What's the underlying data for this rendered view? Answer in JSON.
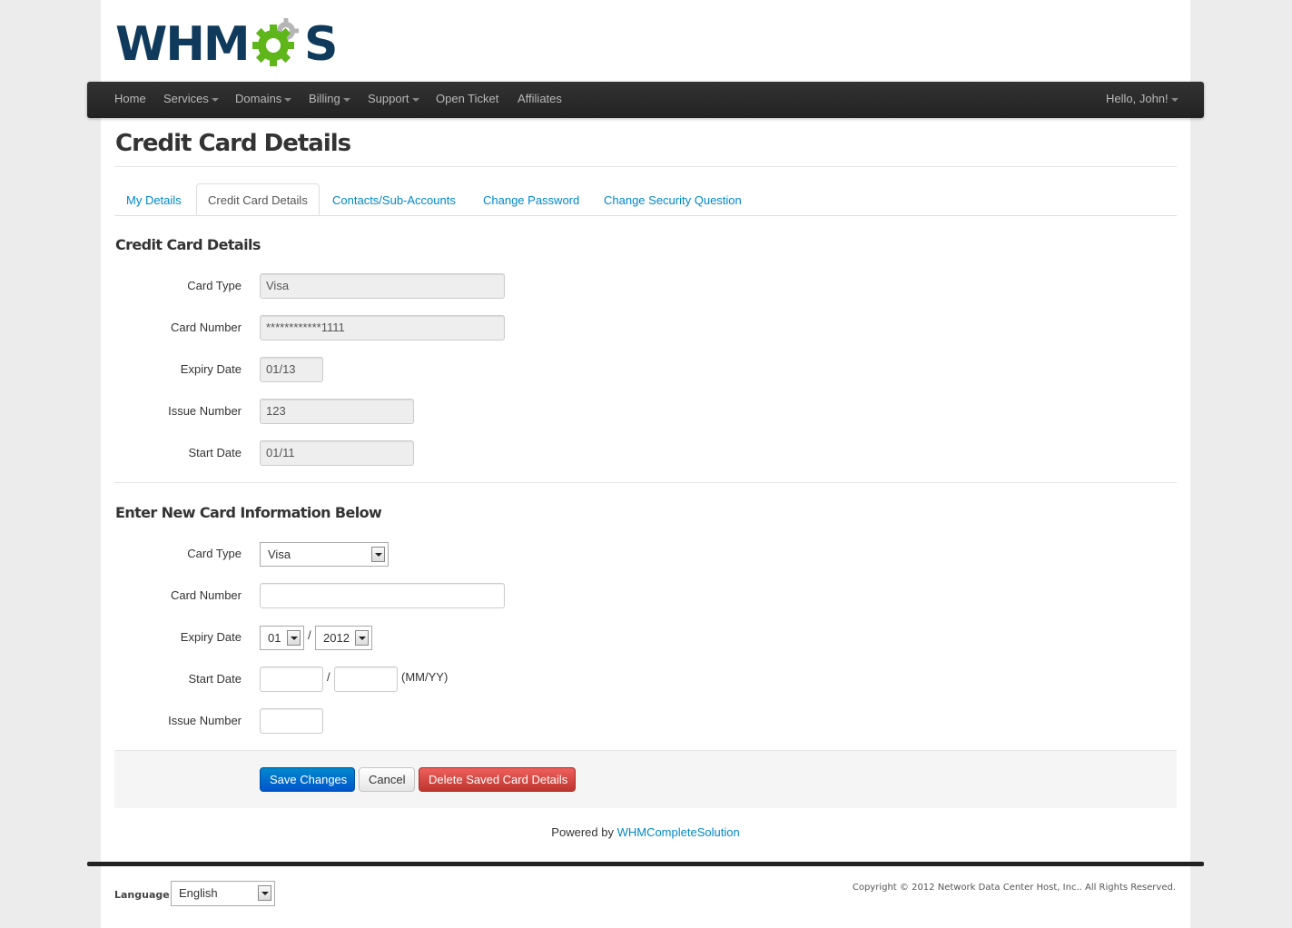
{
  "brand": {
    "logo_text_left": "WHM",
    "logo_text_right": "S",
    "colors": {
      "navy": "#0f3a5b",
      "green": "#5fb61a",
      "gray_gear": "#b5b5b5"
    }
  },
  "navbar": {
    "items": [
      {
        "label": "Home",
        "dropdown": false
      },
      {
        "label": "Services",
        "dropdown": true
      },
      {
        "label": "Domains",
        "dropdown": true
      },
      {
        "label": "Billing",
        "dropdown": true
      },
      {
        "label": "Support",
        "dropdown": true
      },
      {
        "label": "Open Ticket",
        "dropdown": false
      },
      {
        "label": "Affiliates",
        "dropdown": false
      }
    ],
    "user_menu": "Hello, John!"
  },
  "page_title": "Credit Card Details",
  "tabs": [
    {
      "label": "My Details",
      "active": false
    },
    {
      "label": "Credit Card Details",
      "active": true
    },
    {
      "label": "Contacts/Sub-Accounts",
      "active": false
    },
    {
      "label": "Change Password",
      "active": false
    },
    {
      "label": "Change Security Question",
      "active": false
    }
  ],
  "current_card": {
    "title": "Credit Card Details",
    "fields": [
      {
        "label": "Card Type",
        "value": "Visa"
      },
      {
        "label": "Card Number",
        "value": "************1111"
      },
      {
        "label": "Expiry Date",
        "value": "01/13"
      },
      {
        "label": "Issue Number",
        "value": "123"
      },
      {
        "label": "Start Date",
        "value": "01/11"
      }
    ]
  },
  "new_card": {
    "title": "Enter New Card Information Below",
    "card_type_label": "Card Type",
    "card_type_value": "Visa",
    "card_number_label": "Card Number",
    "card_number_value": "",
    "expiry_label": "Expiry Date",
    "expiry_month": "01",
    "expiry_year": "2012",
    "date_separator": "/",
    "start_label": "Start Date",
    "start_month": "",
    "start_year": "",
    "start_hint": "(MM/YY)",
    "issue_label": "Issue Number",
    "issue_value": ""
  },
  "actions": {
    "save": "Save Changes",
    "cancel": "Cancel",
    "delete": "Delete Saved Card Details"
  },
  "footer": {
    "powered_by": "Powered by",
    "powered_link": "WHMCompleteSolution",
    "language_label": "Language:",
    "language_value": "English",
    "copyright": "Copyright © 2012 Network Data Center Host, Inc.. All Rights Reserved."
  }
}
